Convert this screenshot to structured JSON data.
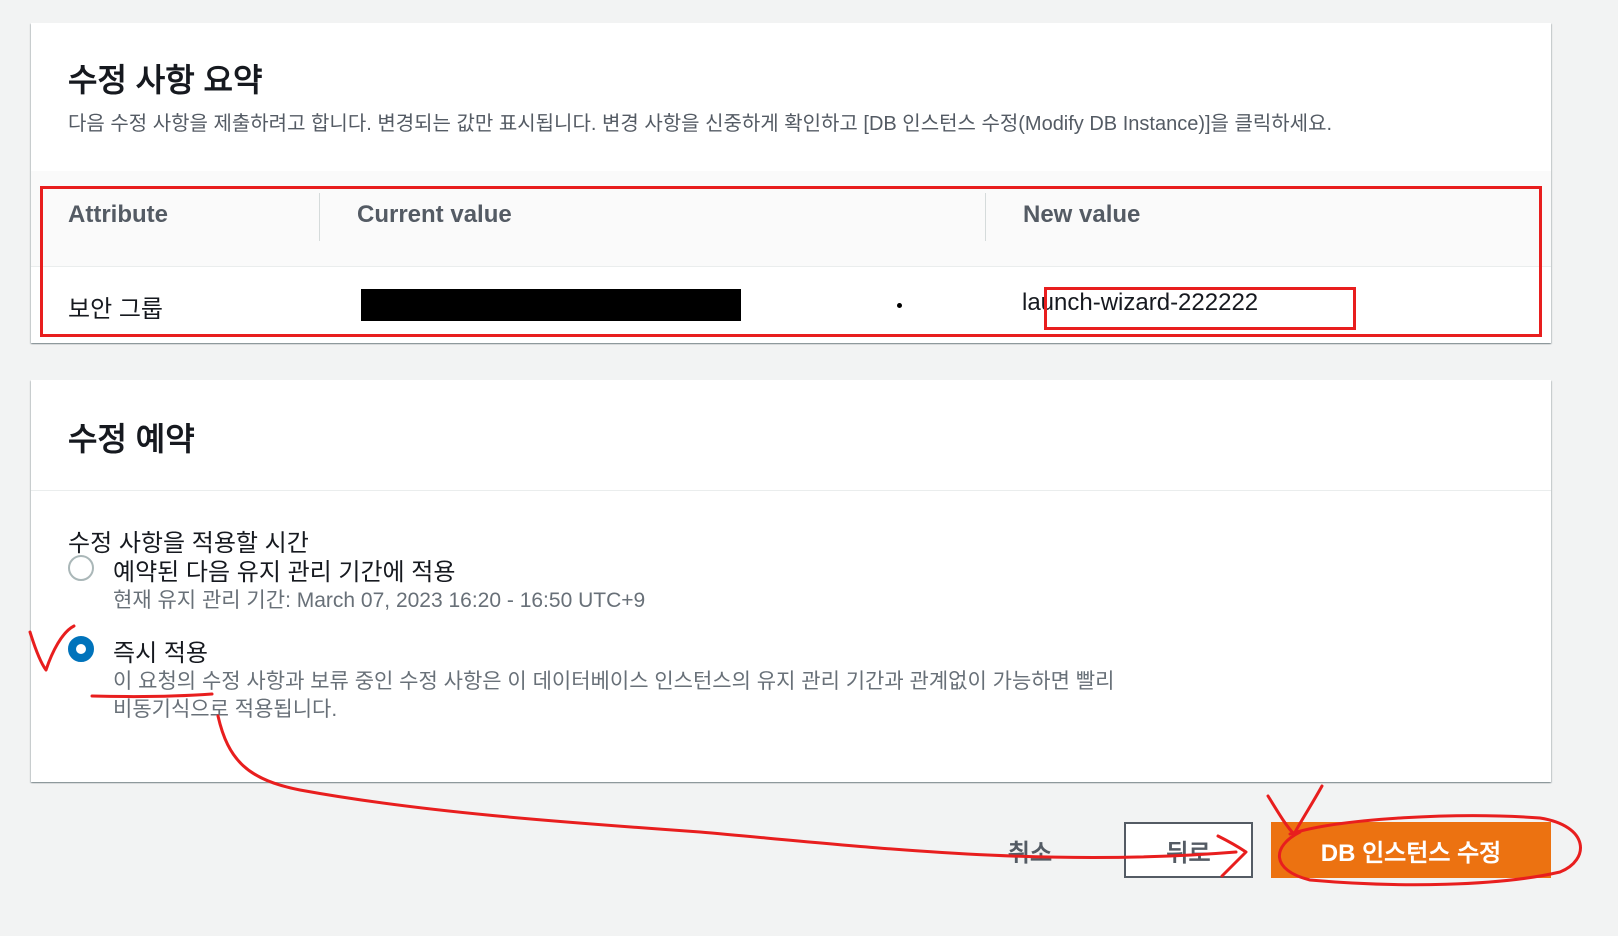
{
  "summary": {
    "title": "수정 사항 요약",
    "description": "다음 수정 사항을 제출하려고 합니다. 변경되는 값만 표시됩니다. 변경 사항을 신중하게 확인하고 [DB 인스턴스 수정(Modify DB Instance)]을 클릭하세요.",
    "columns": [
      "Attribute",
      "Current value",
      "New value"
    ],
    "rows": [
      {
        "attribute": "보안 그룹",
        "current": "",
        "new": "launch-wizard-222222"
      }
    ]
  },
  "schedule": {
    "title": "수정 예약",
    "field_label": "수정 사항을 적용할 시간",
    "options": [
      {
        "label": "예약된 다음 유지 관리 기간에 적용",
        "description": "현재 유지 관리 기간: March 07, 2023 16:20 - 16:50 UTC+9",
        "selected": false
      },
      {
        "label": "즉시 적용",
        "description": "이 요청의 수정 사항과 보류 중인 수정 사항은 이 데이터베이스 인스턴스의 유지 관리 기간과 관계없이 가능하면 빨리 비동기식으로 적용됩니다.",
        "selected": true
      }
    ]
  },
  "actions": {
    "cancel": "취소",
    "back": "뒤로",
    "modify": "DB 인스턴스 수정"
  },
  "colors": {
    "primary_button": "#ec7211",
    "radio_selected": "#0073bb",
    "annotation": "#e81e1e"
  }
}
